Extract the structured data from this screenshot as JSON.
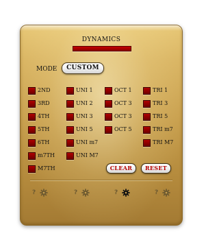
{
  "panel": {
    "title": "DYNAMICS",
    "mode_label": "MODE",
    "mode_value": "CUSTOM"
  },
  "columns": [
    [
      "2ND",
      "3RD",
      "4TH",
      "5TH",
      "6TH",
      "m7TH",
      "M7TH"
    ],
    [
      "UNI 1",
      "UNI 2",
      "UNI 3",
      "UNI 5",
      "UNI m7",
      "UNI M7"
    ],
    [
      "OCT 1",
      "OCT 3",
      "OCT 3",
      "OCT 5"
    ],
    [
      "TRI 1",
      "TRI 3",
      "TRI 5",
      "TRI m7",
      "TRI M7"
    ]
  ],
  "buttons": {
    "clear": "CLEAR",
    "reset": "RESET"
  },
  "footer": {
    "help": "?",
    "groups": [
      {
        "help": "?",
        "gear": "gear-icon",
        "active": false
      },
      {
        "help": "?",
        "gear": "gear-icon",
        "active": false
      },
      {
        "help": "?",
        "gear": "gear-icon",
        "active": true
      },
      {
        "help": "?",
        "gear": "gear-icon",
        "active": false
      }
    ]
  },
  "colors": {
    "accent_red": "#9a0000",
    "gold": "#c9a04e",
    "gear_inactive": "#6e5a30",
    "gear_active": "#111111"
  }
}
